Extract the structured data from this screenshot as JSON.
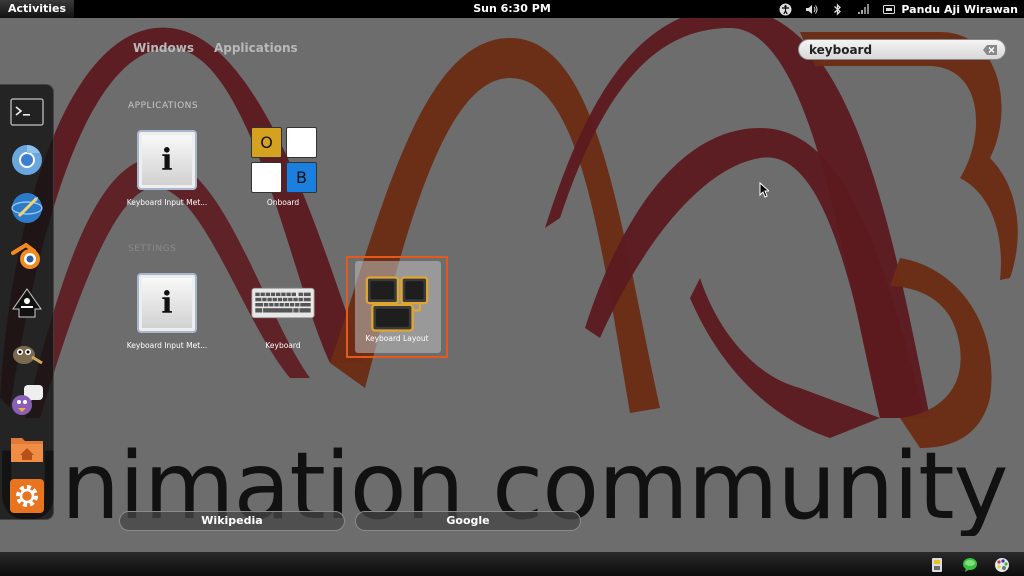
{
  "top_panel": {
    "activities_label": "Activities",
    "clock": "Sun  6:30 PM",
    "user_name": "Pandu Aji Wirawan",
    "tray_icons": [
      "accessibility-icon",
      "volume-icon",
      "bluetooth-icon",
      "network-icon",
      "user-status-icon"
    ]
  },
  "wallpaper": {
    "text": "Unimation community",
    "colors": {
      "maroon": "#5c1a1f",
      "brown": "#6b2c14"
    }
  },
  "overview": {
    "tabs": [
      {
        "label": "Windows"
      },
      {
        "label": "Applications"
      }
    ],
    "search": {
      "value": "keyboard",
      "placeholder": ""
    }
  },
  "dash": {
    "items": [
      {
        "name": "terminal-icon"
      },
      {
        "name": "chromium-icon"
      },
      {
        "name": "web-browser-icon"
      },
      {
        "name": "blender-icon"
      },
      {
        "name": "inkscape-icon"
      },
      {
        "name": "gimp-icon"
      },
      {
        "name": "pidgin-icon"
      },
      {
        "name": "home-folder-icon"
      },
      {
        "name": "settings-icon"
      }
    ]
  },
  "results": {
    "applications_title": "APPLICATIONS",
    "settings_title": "SETTINGS",
    "applications": [
      {
        "label": "Keyboard Input Met...",
        "icon": "info-icon"
      },
      {
        "label": "Onboard",
        "icon": "onboard-icon",
        "keys": [
          "O",
          "",
          "",
          "B"
        ]
      }
    ],
    "settings": [
      {
        "label": "Keyboard Input Met...",
        "icon": "info-icon"
      },
      {
        "label": "Keyboard",
        "icon": "keyboard-icon"
      },
      {
        "label": "Keyboard Layout",
        "icon": "keyboard-layout-icon",
        "selected": true
      }
    ]
  },
  "search_providers": [
    {
      "label": "Wikipedia"
    },
    {
      "label": "Google"
    }
  ],
  "bottom_tray": {
    "icons": [
      "usb-icon",
      "chat-icon",
      "palette-icon"
    ]
  },
  "colors": {
    "selection": "#e55a1c",
    "panel": "#000000"
  }
}
